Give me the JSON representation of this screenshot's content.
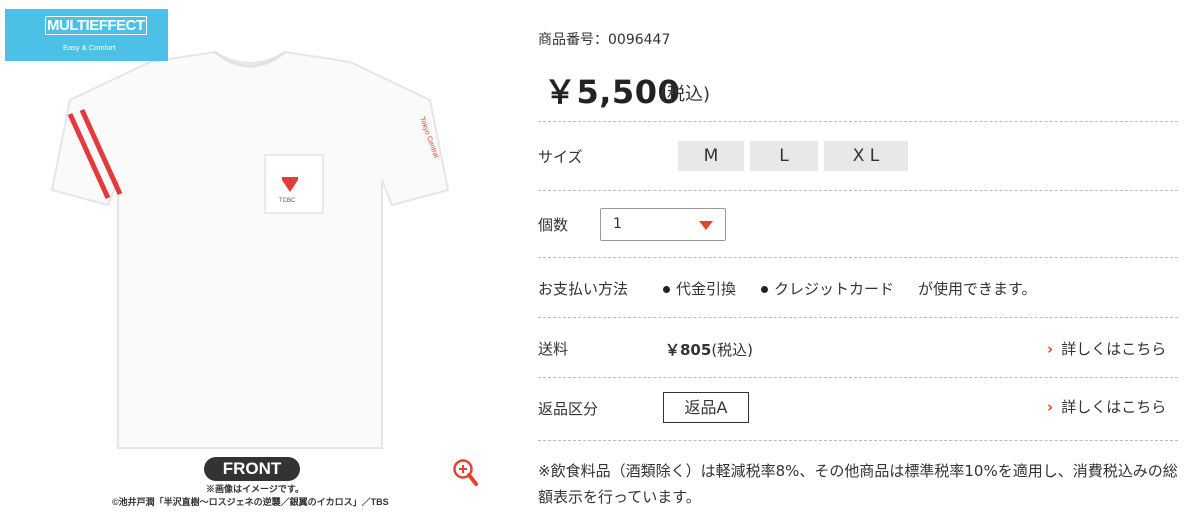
{
  "brand": {
    "name": "MULTIEFFECT",
    "tagline": "Easy & Comfort"
  },
  "image": {
    "label": "FRONT",
    "note": "※画像はイメージです。",
    "copyright": "©池井戸潤「半沢直樹～ロスジェネの逆襲／銀翼のイカロス」／TBS",
    "pocket_logo_text": "TCBC",
    "sleeve_text": "Tokyo Central"
  },
  "product": {
    "number_label": "商品番号：0096447",
    "price": "￥5,500",
    "price_tax": "(税込)"
  },
  "size": {
    "label": "サイズ",
    "options": [
      "M",
      "L",
      "X L"
    ]
  },
  "quantity": {
    "label": "個数",
    "value": "1"
  },
  "payment": {
    "label": "お支払い方法",
    "methods": [
      "代金引換",
      "クレジットカード"
    ],
    "suffix": "が使用できます。"
  },
  "shipping": {
    "label": "送料",
    "price": "￥805",
    "price_tax": "(税込)",
    "link": "詳しくはこちら"
  },
  "returns": {
    "label": "返品区分",
    "value": "返品A",
    "link": "詳しくはこちら"
  },
  "tax_note": "※飲食料品（酒類除く）は軽減税率8%、その他商品は標準税率10%を適用し、消費税込みの総額表示を行っています。",
  "colors": {
    "accent": "#e0452e",
    "brand_bg": "#4cc0e6",
    "size_bg": "#e8e8e8"
  }
}
